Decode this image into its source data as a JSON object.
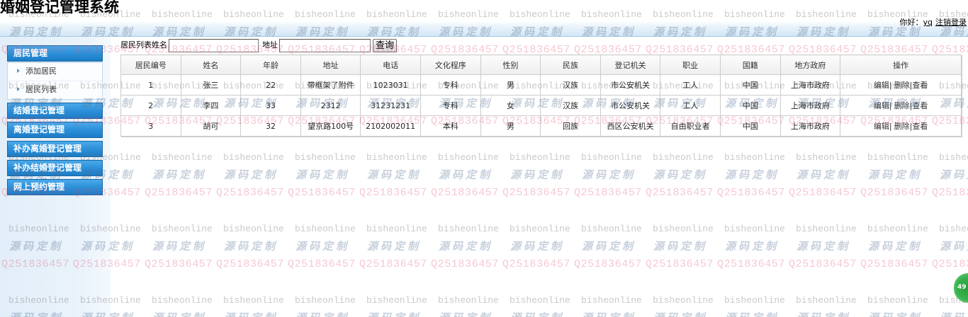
{
  "app": {
    "title": "婚姻登记管理系统"
  },
  "user_bar": {
    "greeting": "你好：",
    "username": "yq",
    "logout_label": "注销登录"
  },
  "sidebar": {
    "groups": [
      {
        "label": "居民管理",
        "items": [
          {
            "label": "添加居民",
            "icon": "triangle-right-icon"
          },
          {
            "label": "居民列表",
            "icon": "triangle-right-icon"
          }
        ]
      },
      {
        "label": "结婚登记管理"
      },
      {
        "label": "离婚登记管理"
      },
      {
        "label": "补办离婚登记管理"
      },
      {
        "label": "补办结婚登记管理"
      },
      {
        "label": "网上预约管理"
      }
    ]
  },
  "search": {
    "section_title": "居民列表",
    "name_label": "姓名",
    "name_value": "",
    "address_label": "地址",
    "address_value": "",
    "submit_label": "查询"
  },
  "table": {
    "columns": [
      "居民编号",
      "姓名",
      "年龄",
      "地址",
      "电话",
      "文化程序",
      "性别",
      "民族",
      "登记机关",
      "职业",
      "国籍",
      "地方政府",
      "操作"
    ],
    "rows": [
      [
        "1",
        "张三",
        "22",
        "带框架了附件",
        "1023031",
        "专科",
        "男",
        "汉族",
        "市公安机关",
        "工人",
        "中国",
        "上海市政府"
      ],
      [
        "2",
        "李四",
        "33",
        "2312",
        "31231231",
        "专科",
        "女",
        "汉族",
        "市公安机关",
        "工人",
        "中国",
        "上海市政府"
      ],
      [
        "3",
        "胡可",
        "32",
        "望京路100号",
        "2102002011",
        "本科",
        "男",
        "回族",
        "西区公安机关",
        "自由职业者",
        "中国",
        "上海市政府"
      ]
    ],
    "row_actions": [
      "编辑",
      "删除",
      "查看"
    ],
    "action_separator": "|"
  },
  "floating_badge": {
    "value": "49"
  },
  "watermark": {
    "line1": "bisheonline",
    "line2": "源码定制",
    "line3": "Q251836457"
  },
  "theme": {
    "menu_header_top": "#4aa9e9",
    "menu_header_bottom": "#1c7cc5",
    "badge_green": "#37b24d",
    "header_band": "#d3e7f6"
  }
}
